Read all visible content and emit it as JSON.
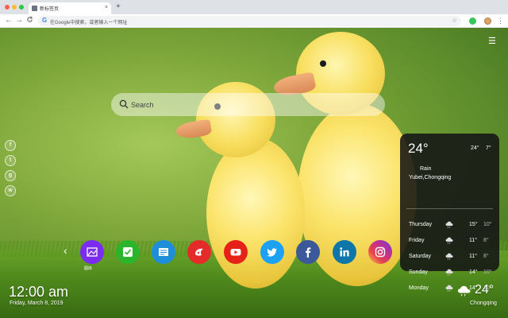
{
  "browser": {
    "tab_title": "新标签页",
    "tab_close": "×",
    "new_tab": "+",
    "address_placeholder": "在Google中搜索，或者输入一个网址",
    "nav": {
      "back": "←",
      "forward": "→",
      "reload": "C"
    }
  },
  "search": {
    "placeholder": "Search"
  },
  "social_links": [
    {
      "icon": "facebook-icon",
      "glyph": "f"
    },
    {
      "icon": "twitter-icon",
      "glyph": "t"
    },
    {
      "icon": "google-icon",
      "glyph": "g"
    },
    {
      "icon": "wechat-icon",
      "glyph": "w"
    }
  ],
  "shortcuts": [
    {
      "icon": "wallpaper-icon",
      "color": "#7b2cf0",
      "label": "图库"
    },
    {
      "icon": "check-icon",
      "color": "#2bb52b"
    },
    {
      "icon": "notes-icon",
      "color": "#1e8ed8"
    },
    {
      "icon": "game-icon",
      "color": "#e52a2a"
    },
    {
      "icon": "youtube-icon",
      "color": "#e62117"
    },
    {
      "icon": "twitter-icon",
      "color": "#1da1f2"
    },
    {
      "icon": "facebook-icon",
      "color": "#3b5998"
    },
    {
      "icon": "linkedin-icon",
      "color": "#0e76a8"
    },
    {
      "icon": "instagram-icon",
      "color": "#d6249f"
    }
  ],
  "clock": {
    "time": "12:00 am",
    "date": "Friday, March 8, 2019"
  },
  "weather": {
    "temp": "24°",
    "high": "24°",
    "low": "7°",
    "condition": "Rain",
    "location": "Yubei,Chongqing",
    "forecast": [
      {
        "day": "Thursday",
        "high": "15°",
        "low": "10°"
      },
      {
        "day": "Friday",
        "high": "11°",
        "low": "8°"
      },
      {
        "day": "Saturday",
        "high": "11°",
        "low": "8°"
      },
      {
        "day": "Sunday",
        "high": "14°",
        "low": "10°"
      },
      {
        "day": "Monday",
        "high": "14°",
        "low": "10°"
      }
    ]
  },
  "weather_corner": {
    "temp": "24°",
    "city": "Chongqing"
  }
}
